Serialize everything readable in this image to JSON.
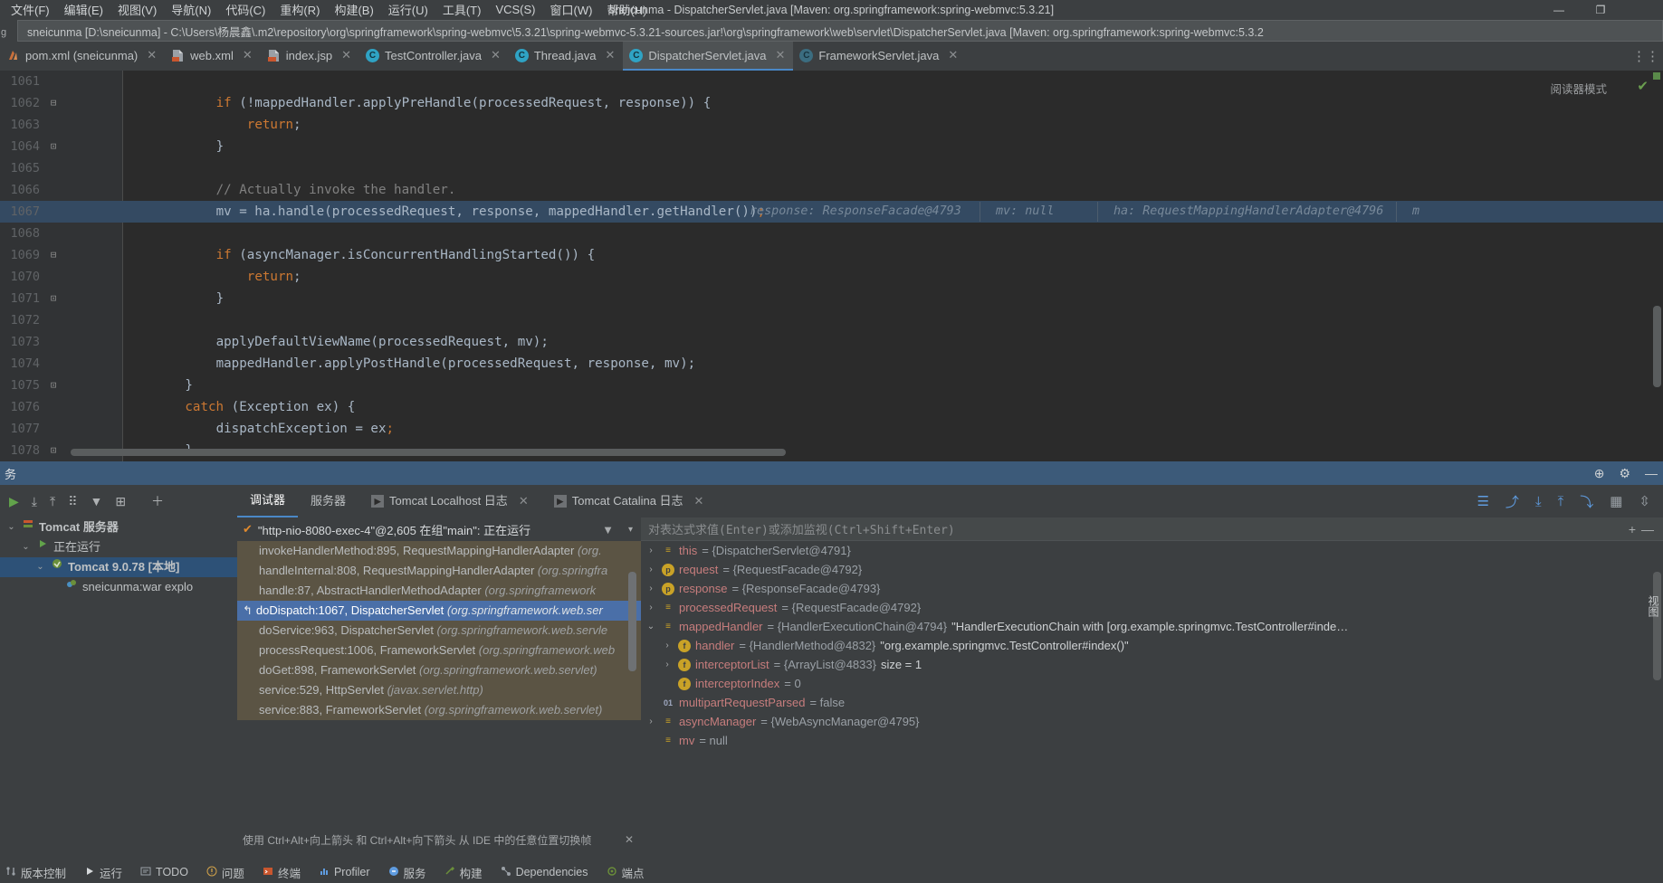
{
  "titlebar": {
    "menus": [
      {
        "label": "文件(F)"
      },
      {
        "label": "编辑(E)"
      },
      {
        "label": "视图(V)"
      },
      {
        "label": "导航(N)"
      },
      {
        "label": "代码(C)"
      },
      {
        "label": "重构(R)"
      },
      {
        "label": "构建(B)"
      },
      {
        "label": "运行(U)"
      },
      {
        "label": "工具(T)"
      },
      {
        "label": "VCS(S)"
      },
      {
        "label": "窗口(W)"
      },
      {
        "label": "帮助(H)"
      }
    ],
    "title": "sneicunma - DispatcherServlet.java [Maven: org.springframework:spring-webmvc:5.3.21]",
    "minimize": "—",
    "restore": "❐",
    "close": "✕"
  },
  "pathstrip": {
    "left_stub": "g",
    "path": "sneicunma [D:\\sneicunma] - C:\\Users\\杨晨鑫\\.m2\\repository\\org\\springframework\\spring-webmvc\\5.3.21\\spring-webmvc-5.3.21-sources.jar!\\org\\springframework\\web\\servlet\\DispatcherServlet.java [Maven: org.springframework:spring-webmvc:5.3.2"
  },
  "tabs": [
    {
      "label": "pom.xml (sneicunma)",
      "icon": "maven-icon",
      "active": false,
      "close": "✕"
    },
    {
      "label": "web.xml",
      "icon": "xml-file-icon",
      "active": false,
      "close": "✕"
    },
    {
      "label": "index.jsp",
      "icon": "jsp-file-icon",
      "active": false,
      "close": "✕"
    },
    {
      "label": "TestController.java",
      "icon": "java-class-icon",
      "active": false,
      "close": "✕"
    },
    {
      "label": "Thread.java",
      "icon": "java-class-icon",
      "active": false,
      "close": "✕"
    },
    {
      "label": "DispatcherServlet.java",
      "icon": "java-class-icon",
      "active": true,
      "close": "✕"
    },
    {
      "label": "FrameworkServlet.java",
      "icon": "java-class-readonly-icon",
      "active": false,
      "close": "✕"
    }
  ],
  "editor": {
    "reader_mode_label": "阅读器模式",
    "lines": [
      {
        "num": "1061",
        "indent": 0,
        "fold": "",
        "segments": [],
        "highlight": false
      },
      {
        "num": "1062",
        "indent": 12,
        "fold": "⊟",
        "highlight": false,
        "segments": [
          {
            "t": "if",
            "c": "kw"
          },
          {
            "t": " (!mappedHandler.applyPreHandle(processedRequest, response)) {",
            "c": "punc"
          }
        ]
      },
      {
        "num": "1063",
        "indent": 16,
        "fold": "",
        "highlight": false,
        "segments": [
          {
            "t": "return",
            "c": "kw"
          },
          {
            "t": ";",
            "c": "punc"
          }
        ]
      },
      {
        "num": "1064",
        "indent": 12,
        "fold": "⊡",
        "highlight": false,
        "segments": [
          {
            "t": "}",
            "c": "punc"
          }
        ]
      },
      {
        "num": "1065",
        "indent": 0,
        "fold": "",
        "highlight": false,
        "segments": []
      },
      {
        "num": "1066",
        "indent": 12,
        "fold": "",
        "highlight": false,
        "segments": [
          {
            "t": "// Actually invoke the handler.",
            "c": "cmt"
          }
        ]
      },
      {
        "num": "1067",
        "indent": 12,
        "fold": "",
        "highlight": true,
        "segments": [
          {
            "t": "mv = ha.handle(processedRequest, response, mappedHandler.getHandler())",
            "c": "punc"
          },
          {
            "t": ";",
            "c": "kw"
          }
        ],
        "hints": [
          "response: ResponseFacade@4793",
          "mv: null",
          "ha: RequestMappingHandlerAdapter@4796",
          "m"
        ]
      },
      {
        "num": "1068",
        "indent": 0,
        "fold": "",
        "highlight": false,
        "segments": []
      },
      {
        "num": "1069",
        "indent": 12,
        "fold": "⊟",
        "highlight": false,
        "segments": [
          {
            "t": "if",
            "c": "kw"
          },
          {
            "t": " (asyncManager.isConcurrentHandlingStarted()) {",
            "c": "punc"
          }
        ]
      },
      {
        "num": "1070",
        "indent": 16,
        "fold": "",
        "highlight": false,
        "segments": [
          {
            "t": "return",
            "c": "kw"
          },
          {
            "t": ";",
            "c": "punc"
          }
        ]
      },
      {
        "num": "1071",
        "indent": 12,
        "fold": "⊡",
        "highlight": false,
        "segments": [
          {
            "t": "}",
            "c": "punc"
          }
        ]
      },
      {
        "num": "1072",
        "indent": 0,
        "fold": "",
        "highlight": false,
        "segments": []
      },
      {
        "num": "1073",
        "indent": 12,
        "fold": "",
        "highlight": false,
        "segments": [
          {
            "t": "applyDefaultViewName(processedRequest, mv);",
            "c": "punc"
          }
        ]
      },
      {
        "num": "1074",
        "indent": 12,
        "fold": "",
        "highlight": false,
        "segments": [
          {
            "t": "mappedHandler.applyPostHandle(processedRequest, response, mv);",
            "c": "punc"
          }
        ]
      },
      {
        "num": "1075",
        "indent": 8,
        "fold": "⊡",
        "highlight": false,
        "segments": [
          {
            "t": "}",
            "c": "punc"
          }
        ]
      },
      {
        "num": "1076",
        "indent": 8,
        "fold": "",
        "highlight": false,
        "segments": [
          {
            "t": "catch",
            "c": "kw"
          },
          {
            "t": " (Exception ex) {",
            "c": "punc"
          }
        ]
      },
      {
        "num": "1077",
        "indent": 12,
        "fold": "",
        "highlight": false,
        "segments": [
          {
            "t": "dispatchException = ex",
            "c": "punc"
          },
          {
            "t": ";",
            "c": "kw"
          }
        ]
      },
      {
        "num": "1078",
        "indent": 8,
        "fold": "⊡",
        "highlight": false,
        "segments": [
          {
            "t": "}",
            "c": "punc"
          }
        ]
      }
    ]
  },
  "toolwindow": {
    "title": "务",
    "actions": [
      "target-icon",
      "gear-icon",
      "minimize-icon"
    ]
  },
  "debug": {
    "left_toolbar_icons": [
      "rerun-icon",
      "expand-all-icon",
      "collapse-all-icon",
      "group-icon",
      "filter-icon",
      "frame-icon",
      "add-icon"
    ],
    "tabs": [
      {
        "label": "调试器",
        "active": true,
        "closable": false
      },
      {
        "label": "服务器",
        "active": false,
        "closable": false
      },
      {
        "label": "Tomcat Localhost 日志",
        "active": false,
        "closable": true,
        "icon": "console-icon"
      },
      {
        "label": "Tomcat Catalina 日志",
        "active": false,
        "closable": true,
        "icon": "console-icon"
      }
    ],
    "tab_actions": [
      "layout-icon",
      "step-over-icon",
      "step-into-icon",
      "step-out-icon",
      "run-to-cursor-icon",
      "evaluate-icon",
      "sort-icon"
    ],
    "services_tree": [
      {
        "indent": 0,
        "twisty": "⌄",
        "icon": "server-icon",
        "label": "Tomcat 服务器",
        "selected": false,
        "bold": true
      },
      {
        "indent": 1,
        "twisty": "⌄",
        "icon": "run-icon",
        "label": "正在运行",
        "selected": false,
        "bold": false
      },
      {
        "indent": 2,
        "twisty": "⌄",
        "icon": "tomcat-icon",
        "label": "Tomcat 9.0.78 [本地]",
        "selected": true,
        "bold": true
      },
      {
        "indent": 3,
        "twisty": "",
        "icon": "artifact-icon",
        "label": "sneicunma:war explo",
        "selected": false,
        "bold": false
      }
    ],
    "thread": {
      "check": "✔",
      "label": "\"http-nio-8080-exec-4\"@2,605 在组\"main\": 正在运行",
      "filter_icon": "filter-icon",
      "dropdown_icon": "chevron-down-icon"
    },
    "frames": [
      {
        "method": "invokeHandlerMethod:895, RequestMappingHandlerAdapter",
        "pkg": "(org.",
        "current": false
      },
      {
        "method": "handleInternal:808, RequestMappingHandlerAdapter",
        "pkg": "(org.springfra",
        "current": false
      },
      {
        "method": "handle:87, AbstractHandlerMethodAdapter",
        "pkg": "(org.springframework",
        "current": false
      },
      {
        "method": "doDispatch:1067, DispatcherServlet",
        "pkg": "(org.springframework.web.ser",
        "current": true
      },
      {
        "method": "doService:963, DispatcherServlet",
        "pkg": "(org.springframework.web.servle",
        "current": false
      },
      {
        "method": "processRequest:1006, FrameworkServlet",
        "pkg": "(org.springframework.web",
        "current": false
      },
      {
        "method": "doGet:898, FrameworkServlet",
        "pkg": "(org.springframework.web.servlet)",
        "current": false
      },
      {
        "method": "service:529, HttpServlet",
        "pkg": "(javax.servlet.http)",
        "current": false
      },
      {
        "method": "service:883, FrameworkServlet",
        "pkg": "(org.springframework.web.servlet)",
        "current": false
      }
    ],
    "frames_hint": "使用 Ctrl+Alt+向上箭头 和 Ctrl+Alt+向下箭头 从 IDE 中的任意位置切换帧",
    "frames_hint_close": "✕",
    "watch_placeholder": "对表达式求值(Enter)或添加监视(Ctrl+Shift+Enter)",
    "watch_add": "+",
    "watch_remove": "—",
    "variables": [
      {
        "indent": 0,
        "twisty": "›",
        "icon": "field",
        "iconGlyph": "≡",
        "name": "this",
        "value": "= {DispatcherServlet@4791}",
        "str": ""
      },
      {
        "indent": 0,
        "twisty": "›",
        "icon": "param",
        "iconGlyph": "p",
        "name": "request",
        "value": "= {RequestFacade@4792}",
        "str": ""
      },
      {
        "indent": 0,
        "twisty": "›",
        "icon": "param",
        "iconGlyph": "p",
        "name": "response",
        "value": "= {ResponseFacade@4793}",
        "str": ""
      },
      {
        "indent": 0,
        "twisty": "›",
        "icon": "field",
        "iconGlyph": "≡",
        "name": "processedRequest",
        "value": "= {RequestFacade@4792}",
        "str": ""
      },
      {
        "indent": 0,
        "twisty": "⌄",
        "icon": "field",
        "iconGlyph": "≡",
        "name": "mappedHandler",
        "value": "= {HandlerExecutionChain@4794}",
        "str": "\"HandlerExecutionChain with [org.example.springmvc.TestController#inde…"
      },
      {
        "indent": 1,
        "twisty": "›",
        "icon": "param",
        "iconGlyph": "f",
        "name": "handler",
        "value": "= {HandlerMethod@4832}",
        "str": "\"org.example.springmvc.TestController#index()\""
      },
      {
        "indent": 1,
        "twisty": "›",
        "icon": "param",
        "iconGlyph": "f",
        "name": "interceptorList",
        "value": "= {ArrayList@4833}",
        "str": "size = 1"
      },
      {
        "indent": 1,
        "twisty": "",
        "icon": "param",
        "iconGlyph": "f",
        "name": "interceptorIndex",
        "value": "= 0",
        "str": ""
      },
      {
        "indent": 0,
        "twisty": "",
        "icon": "bool",
        "iconGlyph": "01",
        "name": "multipartRequestParsed",
        "value": "= false",
        "str": ""
      },
      {
        "indent": 0,
        "twisty": "›",
        "icon": "field",
        "iconGlyph": "≡",
        "name": "asyncManager",
        "value": "= {WebAsyncManager@4795}",
        "str": ""
      },
      {
        "indent": 0,
        "twisty": "",
        "icon": "field",
        "iconGlyph": "≡",
        "name": "mv",
        "value": "= null",
        "str": ""
      }
    ],
    "vars_side_note": "视图"
  },
  "statusbar": [
    {
      "label": "版本控制",
      "icon": "vcs-icon",
      "color": "#bfc2c4"
    },
    {
      "label": "运行",
      "icon": "run-icon",
      "color": "#bfc2c4"
    },
    {
      "label": "TODO",
      "icon": "todo-icon",
      "color": "#bfc2c4"
    },
    {
      "label": "问题",
      "icon": "problems-icon",
      "color": "#bfc2c4"
    },
    {
      "label": "终端",
      "icon": "terminal-icon",
      "color": "#bfc2c4"
    },
    {
      "label": "Profiler",
      "icon": "profiler-icon",
      "color": "#bfc2c4"
    },
    {
      "label": "服务",
      "icon": "services-icon",
      "color": "#bfc2c4"
    },
    {
      "label": "构建",
      "icon": "build-icon",
      "color": "#bfc2c4"
    },
    {
      "label": "Dependencies",
      "icon": "dependencies-icon",
      "color": "#bfc2c4"
    },
    {
      "label": "端点",
      "icon": "endpoints-icon",
      "color": "#bfc2c4"
    }
  ]
}
